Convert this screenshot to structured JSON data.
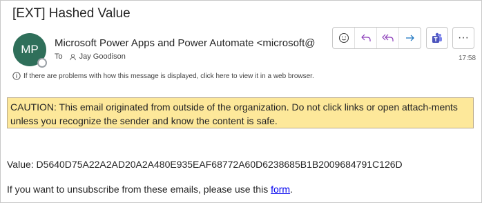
{
  "subject": "[EXT] Hashed Value",
  "avatar_initials": "MP",
  "sender": "Microsoft Power Apps and Power Automate <microsoft@",
  "to_label": "To",
  "recipient": "Jay Goodison",
  "time": "17:58",
  "info_text": "If there are problems with how this message is displayed, click here to view it in a web browser.",
  "caution_text": "CAUTION: This email originated from outside of the organization. Do not click links or open attach-ments unless you recognize the sender and know the content is safe.",
  "body": {
    "value_line": "Value: D5640D75A22A2AD20A2A480E935EAF68772A60D6238685B1B2009684791C126D",
    "unsubscribe_prefix": "If you want to unsubscribe from these emails, please use this ",
    "unsubscribe_link": "form",
    "unsubscribe_suffix": "."
  },
  "more_label": "···",
  "colors": {
    "accent": "#8a3ab9",
    "reply_blue": "#0f6cbd",
    "teams": "#5059c9",
    "caution_bg": "#fde89a",
    "avatar": "#2f6f5a"
  },
  "icons": [
    "emoji-icon",
    "reply-icon",
    "reply-all-icon",
    "forward-icon",
    "teams-icon",
    "more-icon",
    "info-icon",
    "person-icon"
  ]
}
